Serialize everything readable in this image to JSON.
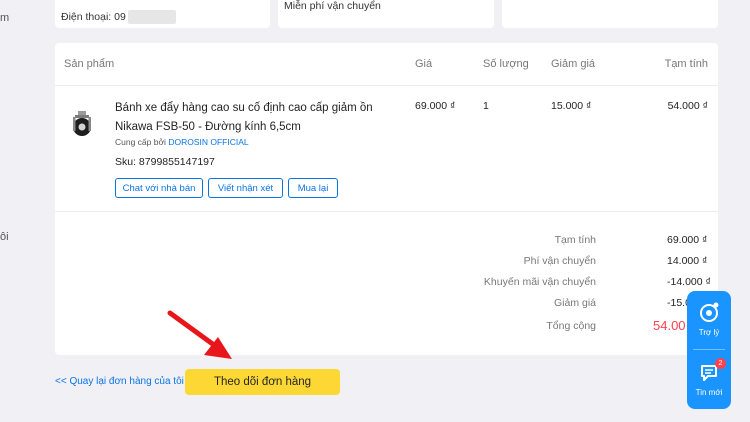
{
  "sidebar": {
    "frag_top": "m",
    "frag_mid": "ôi"
  },
  "info_cards": {
    "address_phone_label": "Điện thoại: 09",
    "shipping_fee_text": "Miễn phí vận chuyển"
  },
  "table": {
    "headers": {
      "product": "Sản phẩm",
      "price": "Giá",
      "qty": "Số lượng",
      "discount": "Giảm giá",
      "subtotal": "Tạm tính"
    },
    "item": {
      "name": "Bánh xe đẩy hàng cao su cố định cao cấp giảm ồn Nikawa FSB-50 - Đường kính 6,5cm",
      "seller_prefix": "Cung cấp bởi",
      "seller_name": "DOROSIN OFFICIAL",
      "sku": "Sku: 8799855147197",
      "price": "69.000 ₫",
      "qty": "1",
      "discount": "15.000 ₫",
      "subtotal": "54.000 ₫",
      "buttons": {
        "chat": "Chat với nhà bán",
        "review": "Viết nhận xét",
        "rebuy": "Mua lại"
      }
    }
  },
  "summary": {
    "subtotal_label": "Tạm tính",
    "subtotal_value": "69.000 ₫",
    "shipping_label": "Phí vận chuyển",
    "shipping_value": "14.000 ₫",
    "ship_promo_label": "Khuyến mãi vận chuyển",
    "ship_promo_value": "-14.000 ₫",
    "discount_label": "Giảm giá",
    "discount_value": "-15.00",
    "total_label": "Tổng cộng",
    "total_value": "54.00"
  },
  "footer": {
    "back_link": "<< Quay lại đơn hàng của tôi",
    "track_button": "Theo dõi đơn hàng"
  },
  "chat_widget": {
    "assistant_label": "Trợ lý",
    "messages_label": "Tin mới",
    "messages_badge": "2"
  },
  "colors": {
    "accent": "#0b74e5",
    "total": "#ff424e",
    "track_button": "#fdd835",
    "widget": "#1a94ff",
    "annotation_arrow": "#e8161a"
  }
}
